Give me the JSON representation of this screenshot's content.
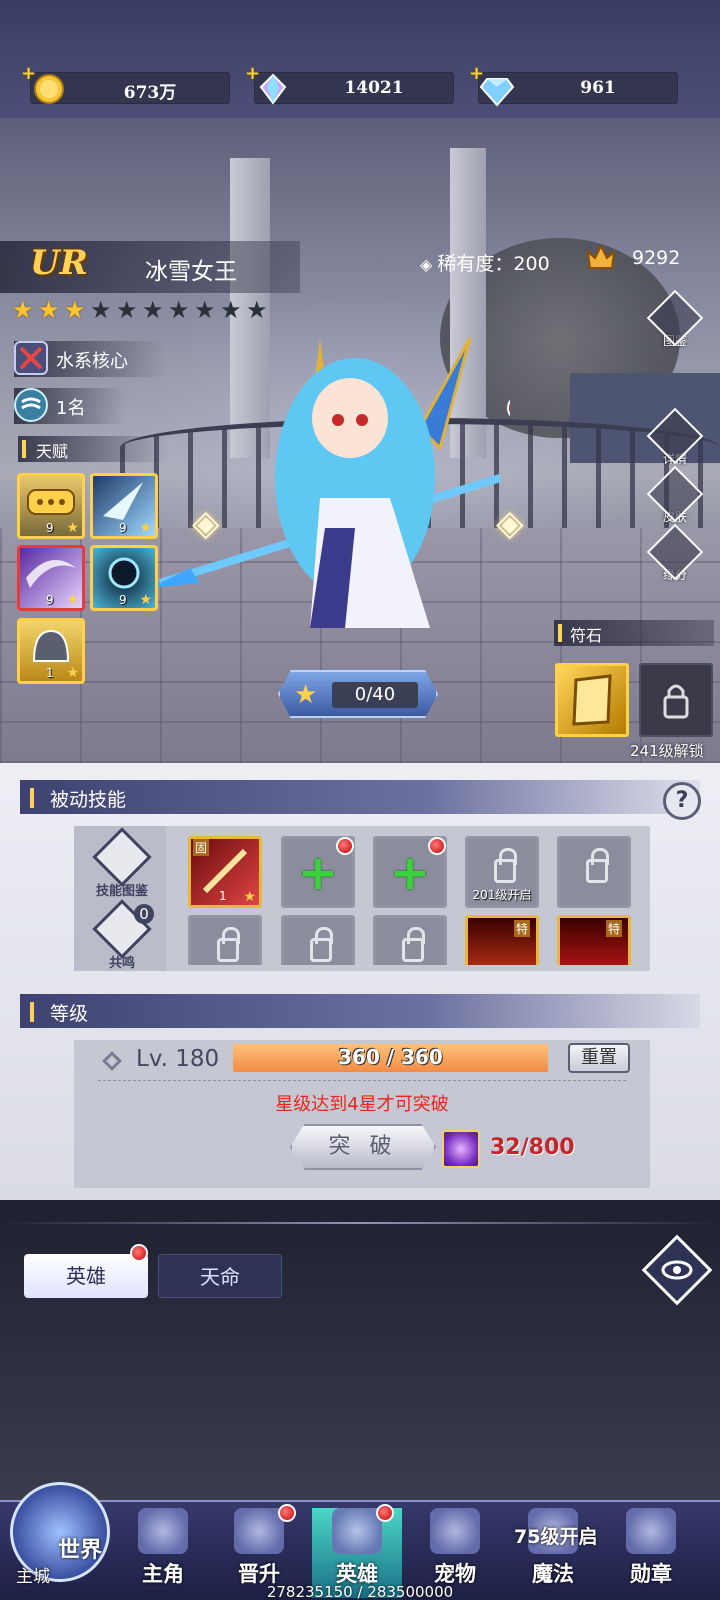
{
  "currency": {
    "gold": "673万",
    "crystal": "14021",
    "diamond": "961"
  },
  "hero": {
    "grade": "UR",
    "name": "冰雪女王",
    "rarity_label": "稀有度：",
    "rarity_value": "200",
    "power": "9292",
    "stars_total": 10,
    "stars_filled": 3,
    "role": "水系核心",
    "rank": "1名"
  },
  "talent": {
    "title": "天赋",
    "items": [
      {
        "level": "9",
        "name": "talent-chat"
      },
      {
        "level": "9",
        "name": "talent-ice-shard"
      },
      {
        "level": "9",
        "name": "talent-purple-wind"
      },
      {
        "level": "9",
        "name": "talent-frost-burst"
      },
      {
        "level": "1",
        "name": "talent-helmet"
      }
    ]
  },
  "side_buttons": [
    "图鉴",
    "详情",
    "皮肤",
    "缘分"
  ],
  "star_progress": "0/40",
  "rune": {
    "title": "符石",
    "lock_text": "241级解锁"
  },
  "passive": {
    "title": "被动技能",
    "help": "?",
    "tool_gallery": "技能图鉴",
    "tool_resonance": "共鸣",
    "resonance_count": "0",
    "slot_unlock_text": "201级开启",
    "skill_level": "1",
    "fixed_tag": "固",
    "special_tag": "特"
  },
  "level": {
    "title": "等级",
    "label": "Lv. 180",
    "exp": "360 / 360",
    "exp_fraction": 1.0,
    "reset": "重置",
    "warning": "星级达到4星才可突破",
    "breakthrough": "突 破",
    "cost": "32/800"
  },
  "tabs": {
    "hero": "英雄",
    "fate": "天命"
  },
  "nav": {
    "world": "世界",
    "city": "主城",
    "items": [
      "主角",
      "晋升",
      "英雄",
      "宠物",
      "魔法",
      "勋章"
    ],
    "unlock_note": "75级开启",
    "footer": "278235150 / 283500000"
  },
  "colors": {
    "gold_accent": "#ffd14a",
    "warning_red": "#e5271e",
    "exp_orange": "#f28b46",
    "nav_active": "#4cd7c7"
  }
}
